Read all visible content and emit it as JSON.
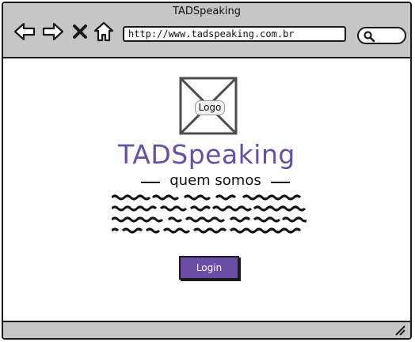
{
  "window": {
    "title": "TADSpeaking"
  },
  "toolbar": {
    "back_icon": "arrow-left-icon",
    "forward_icon": "arrow-right-icon",
    "stop_icon": "close-icon",
    "home_icon": "home-icon",
    "url": "http://www.tadspeaking.com.br",
    "search_icon": "search-icon"
  },
  "content": {
    "logo_label": "Logo",
    "brand_title": "TADSpeaking",
    "subtitle": "quem somos",
    "login_label": "Login"
  },
  "colors": {
    "accent": "#6a4ea6",
    "chrome": "#c6c6c6"
  }
}
